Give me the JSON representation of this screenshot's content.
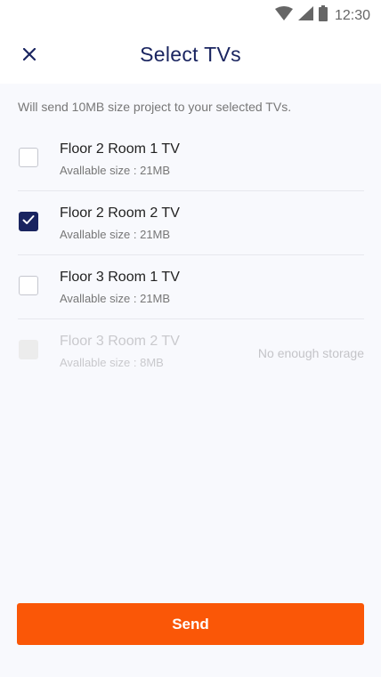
{
  "status_bar": {
    "time": "12:30",
    "icons": [
      "wifi-icon",
      "cell-signal-icon",
      "battery-icon"
    ]
  },
  "header": {
    "title": "Select TVs",
    "close_icon": "close-icon"
  },
  "info": {
    "text": "Will send 10MB size project to your selected TVs."
  },
  "tvs": [
    {
      "name": "Floor 2 Room 1 TV",
      "size": "Avallable size : 21MB",
      "checked": false,
      "disabled": false,
      "note": ""
    },
    {
      "name": "Floor 2 Room 2 TV",
      "size": "Avallable size : 21MB",
      "checked": true,
      "disabled": false,
      "note": ""
    },
    {
      "name": "Floor 3 Room 1 TV",
      "size": "Avallable size : 21MB",
      "checked": false,
      "disabled": false,
      "note": ""
    },
    {
      "name": "Floor 3 Room 2 TV",
      "size": "Avallable size : 8MB",
      "checked": false,
      "disabled": true,
      "note": "No enough storage"
    }
  ],
  "actions": {
    "send_label": "Send"
  },
  "colors": {
    "accent": "#fa5707",
    "brand": "#1a2560",
    "background": "#f8f9fd"
  }
}
